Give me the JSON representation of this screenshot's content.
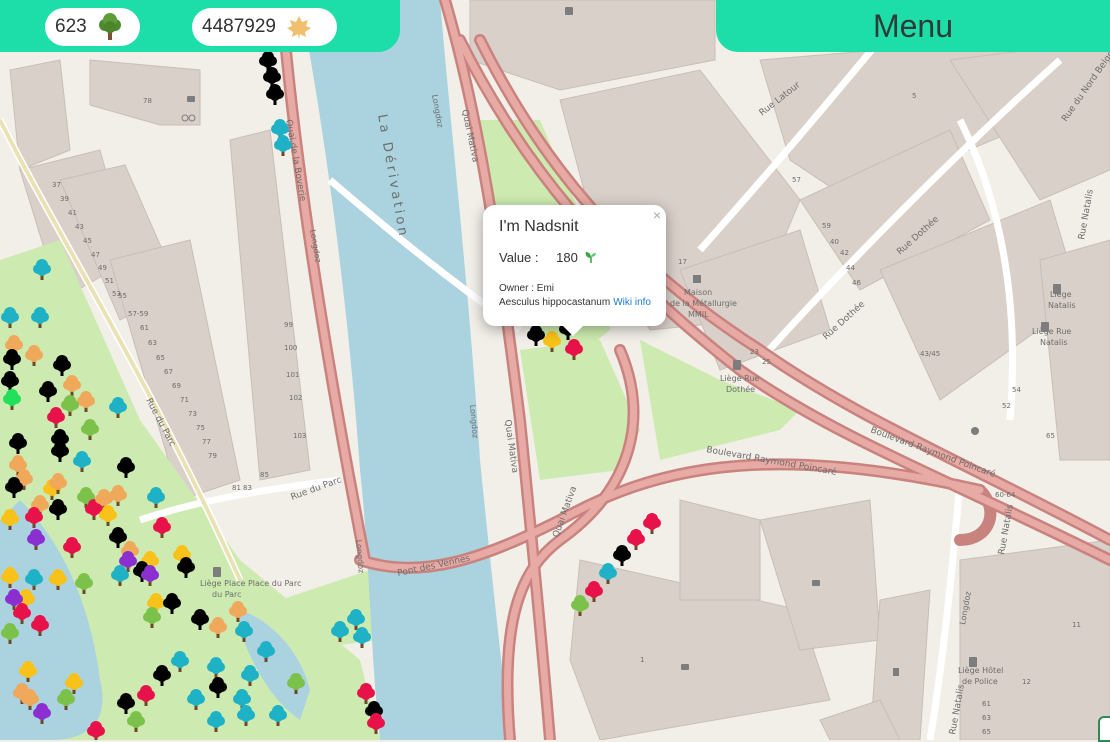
{
  "counters": {
    "trees_count": "623",
    "leaves_count": "4487929"
  },
  "icons": {
    "tree": "tree-icon",
    "leaf": "maple-leaf-icon",
    "sprout": "sprout-icon",
    "close": "close-icon"
  },
  "menu": {
    "label": "Menu"
  },
  "popup": {
    "title": "I'm Nadsnit",
    "value_label": "Value :",
    "value": "180",
    "owner": "Owner : Emi",
    "species": "Aesculus hippocastanum",
    "link": "Wiki info",
    "close": "×"
  },
  "colors": {
    "accent": "#1ddea9",
    "water": "#aad3df",
    "park": "#cdebb0",
    "road": "#dc9f9a",
    "link": "#1a7ccf"
  },
  "map_labels": {
    "river_name": "La Dérivation",
    "quai_bovery": "Quai de la Boverie",
    "quai_mativa_top": "Quai Mativa",
    "quai_mativa_mid": "Quai Mativa",
    "quai_mativa_low": "Quai Mativa",
    "longdoz_1": "Longdoz",
    "longdoz_2": "Longdoz",
    "longdoz_3": "Longdoz",
    "longdoz_4": "Longdoz",
    "longdoz_5": "Longdoz",
    "rue_du_parc_1": "Rue du Parc",
    "rue_du_parc_2": "Rue du Parc",
    "pont_des_vennes": "Pont des Vennes",
    "bd_poincare_1": "Boulevard Raymond Poincaré",
    "bd_poincare_2": "Boulevard Raymond Poincaré",
    "rue_dothee_1": "Rue Dothée",
    "rue_dothee_2": "Rue Dothée",
    "rue_latour": "Rue Latour",
    "rue_natalis_1": "Rue Natalis",
    "rue_natalis_2": "Rue Natalis",
    "rue_natalis_3": "Rue Natalis",
    "rue_du_nord_belge": "Rue du Nord Belge",
    "maison_1": "Maison",
    "maison_2": "de la Métallurgie",
    "maison_3": "MMIL",
    "stop_dothee_1": "Liège Rue",
    "stop_dothee_2": "Dothée",
    "stop_natalis_a1": "Liège",
    "stop_natalis_a2": "Natalis",
    "stop_natalis_b1": "Liège Rue",
    "stop_natalis_b2": "Natalis",
    "stop_parc_1": "Liège Place Place du Parc",
    "stop_parc_2": "du Parc",
    "stop_police_1": "Liège Hôtel",
    "stop_police_2": "de Police"
  },
  "house_numbers": {
    "h1": "78",
    "h2": "37",
    "h3": "39",
    "h4": "41",
    "h5": "43",
    "h6": "45",
    "h7": "47",
    "h8": "49",
    "h9": "51",
    "h10": "53",
    "h11": "55",
    "h12": "57-59",
    "h13": "61",
    "h14": "63",
    "h15": "65",
    "h16": "67",
    "h17": "69",
    "h18": "71",
    "h19": "73",
    "h20": "75",
    "h21": "77",
    "h22": "79",
    "h23": "99",
    "h24": "100",
    "h25": "101",
    "h26": "102",
    "h27": "103",
    "h28": "85",
    "h29": "83",
    "h30": "81",
    "h31": "17",
    "h32": "25",
    "h33": "23",
    "h34": "57",
    "h35": "59",
    "h36": "5",
    "h37": "43/45",
    "h38": "54",
    "h39": "52",
    "h40": "65",
    "h41": "1",
    "h42": "12",
    "h43": "60-64",
    "h44": "61",
    "h45": "63",
    "h46": "65",
    "h47": "11",
    "h48": "42",
    "h49": "44",
    "h50": "46",
    "h51": "40"
  }
}
